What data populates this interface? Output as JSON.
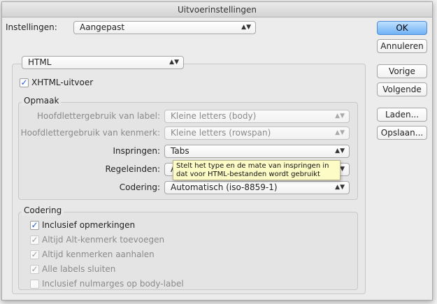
{
  "window": {
    "title": "Uitvoerinstellingen"
  },
  "settings": {
    "label": "Instellingen:",
    "value": "Aangepast"
  },
  "format": {
    "value": "HTML"
  },
  "xhtml": {
    "label": "XHTML-uitvoer",
    "checked": true
  },
  "opmaak": {
    "title": "Opmaak",
    "rows": {
      "label_case": {
        "label": "Hoofdlettergebruik van label:",
        "value": "Kleine letters (body)",
        "enabled": false
      },
      "attr_case": {
        "label": "Hoofdlettergebruik van kenmerk:",
        "value": "Kleine letters (rowspan)",
        "enabled": false
      },
      "indent": {
        "label": "Inspringen:",
        "value": "Tabs",
        "enabled": true
      },
      "line_endings": {
        "label": "Regeleinden:",
        "value": "A",
        "enabled": true
      },
      "encoding": {
        "label": "Codering:",
        "value": "Automatisch (iso-8859-1)",
        "enabled": true
      }
    }
  },
  "tooltip": {
    "text": "Stelt het type en de mate van inspringen in dat voor HTML-bestanden wordt gebruikt"
  },
  "codering": {
    "title": "Codering",
    "options": [
      {
        "label": "Inclusief opmerkingen",
        "checked": true,
        "enabled": true
      },
      {
        "label": "Altijd Alt-kenmerk toevoegen",
        "checked": true,
        "enabled": false
      },
      {
        "label": "Altijd kenmerken aanhalen",
        "checked": true,
        "enabled": false
      },
      {
        "label": "Alle labels sluiten",
        "checked": true,
        "enabled": false
      },
      {
        "label": "Inclusief nulmarges op body-label",
        "checked": false,
        "enabled": false
      }
    ]
  },
  "buttons": {
    "ok": "OK",
    "cancel": "Annuleren",
    "previous": "Vorige",
    "next": "Volgende",
    "load": "Laden...",
    "save": "Opslaan..."
  },
  "icons": {
    "check": "checkmark-icon",
    "popup_arrow": "updown-arrows-icon"
  },
  "colors": {
    "default_button": "#6fb2f5",
    "tooltip_bg": "#fdfbc6",
    "checkmark": "#1d5bd1"
  }
}
